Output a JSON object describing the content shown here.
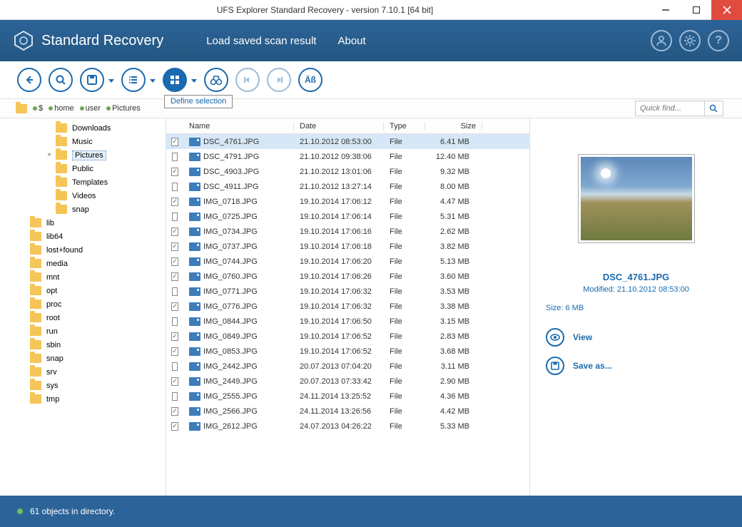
{
  "window": {
    "title": "UFS Explorer Standard Recovery - version 7.10.1 [64 bit]"
  },
  "header": {
    "app_name": "Standard Recovery",
    "menu_load": "Load saved scan result",
    "menu_about": "About"
  },
  "tooltip": {
    "define_selection": "Define selection"
  },
  "breadcrumb": [
    "$",
    "home",
    "user",
    "Pictures"
  ],
  "quickfind_placeholder": "Quick find...",
  "tree": [
    {
      "label": "Downloads",
      "depth": 3,
      "twisty": ""
    },
    {
      "label": "Music",
      "depth": 3,
      "twisty": ""
    },
    {
      "label": "Pictures",
      "depth": 3,
      "twisty": "+",
      "selected": true
    },
    {
      "label": "Public",
      "depth": 3,
      "twisty": ""
    },
    {
      "label": "Templates",
      "depth": 3,
      "twisty": ""
    },
    {
      "label": "Videos",
      "depth": 3,
      "twisty": ""
    },
    {
      "label": "snap",
      "depth": 3,
      "twisty": ""
    },
    {
      "label": "lib",
      "depth": 1,
      "twisty": ""
    },
    {
      "label": "lib64",
      "depth": 1,
      "twisty": ""
    },
    {
      "label": "lost+found",
      "depth": 1,
      "twisty": ""
    },
    {
      "label": "media",
      "depth": 1,
      "twisty": ""
    },
    {
      "label": "mnt",
      "depth": 1,
      "twisty": ""
    },
    {
      "label": "opt",
      "depth": 1,
      "twisty": ""
    },
    {
      "label": "proc",
      "depth": 1,
      "twisty": ""
    },
    {
      "label": "root",
      "depth": 1,
      "twisty": ""
    },
    {
      "label": "run",
      "depth": 1,
      "twisty": ""
    },
    {
      "label": "sbin",
      "depth": 1,
      "twisty": ""
    },
    {
      "label": "snap",
      "depth": 1,
      "twisty": ""
    },
    {
      "label": "srv",
      "depth": 1,
      "twisty": ""
    },
    {
      "label": "sys",
      "depth": 1,
      "twisty": ""
    },
    {
      "label": "tmp",
      "depth": 1,
      "twisty": ""
    }
  ],
  "columns": {
    "name": "Name",
    "date": "Date",
    "type": "Type",
    "size": "Size"
  },
  "files": [
    {
      "checked": true,
      "name": "DSC_4761.JPG",
      "date": "21.10.2012 08:53:00",
      "type": "File",
      "size": "6.41 MB",
      "selected": true
    },
    {
      "checked": false,
      "name": "DSC_4791.JPG",
      "date": "21.10.2012 09:38:06",
      "type": "File",
      "size": "12.40 MB"
    },
    {
      "checked": true,
      "name": "DSC_4903.JPG",
      "date": "21.10.2012 13:01:06",
      "type": "File",
      "size": "9.32 MB"
    },
    {
      "checked": false,
      "name": "DSC_4911.JPG",
      "date": "21.10.2012 13:27:14",
      "type": "File",
      "size": "8.00 MB"
    },
    {
      "checked": true,
      "name": "IMG_0718.JPG",
      "date": "19.10.2014 17:06:12",
      "type": "File",
      "size": "4.47 MB"
    },
    {
      "checked": false,
      "name": "IMG_0725.JPG",
      "date": "19.10.2014 17:06:14",
      "type": "File",
      "size": "5.31 MB"
    },
    {
      "checked": true,
      "name": "IMG_0734.JPG",
      "date": "19.10.2014 17:06:16",
      "type": "File",
      "size": "2.62 MB"
    },
    {
      "checked": true,
      "name": "IMG_0737.JPG",
      "date": "19.10.2014 17:06:18",
      "type": "File",
      "size": "3.82 MB"
    },
    {
      "checked": true,
      "name": "IMG_0744.JPG",
      "date": "19.10.2014 17:06:20",
      "type": "File",
      "size": "5.13 MB"
    },
    {
      "checked": true,
      "name": "IMG_0760.JPG",
      "date": "19.10.2014 17:06:26",
      "type": "File",
      "size": "3.60 MB"
    },
    {
      "checked": false,
      "name": "IMG_0771.JPG",
      "date": "19.10.2014 17:06:32",
      "type": "File",
      "size": "3.53 MB"
    },
    {
      "checked": true,
      "name": "IMG_0776.JPG",
      "date": "19.10.2014 17:06:32",
      "type": "File",
      "size": "3.38 MB"
    },
    {
      "checked": false,
      "name": "IMG_0844.JPG",
      "date": "19.10.2014 17:06:50",
      "type": "File",
      "size": "3.15 MB"
    },
    {
      "checked": true,
      "name": "IMG_0849.JPG",
      "date": "19.10.2014 17:06:52",
      "type": "File",
      "size": "2.83 MB"
    },
    {
      "checked": true,
      "name": "IMG_0853.JPG",
      "date": "19.10.2014 17:06:52",
      "type": "File",
      "size": "3.68 MB"
    },
    {
      "checked": false,
      "name": "IMG_2442.JPG",
      "date": "20.07.2013 07:04:20",
      "type": "File",
      "size": "3.11 MB"
    },
    {
      "checked": true,
      "name": "IMG_2449.JPG",
      "date": "20.07.2013 07:33:42",
      "type": "File",
      "size": "2.90 MB"
    },
    {
      "checked": false,
      "name": "IMG_2555.JPG",
      "date": "24.11.2014 13:25:52",
      "type": "File",
      "size": "4.36 MB"
    },
    {
      "checked": true,
      "name": "IMG_2566.JPG",
      "date": "24.11.2014 13:26:56",
      "type": "File",
      "size": "4.42 MB"
    },
    {
      "checked": true,
      "name": "IMG_2612.JPG",
      "date": "24.07.2013 04:26:22",
      "type": "File",
      "size": "5.33 MB"
    }
  ],
  "preview": {
    "name": "DSC_4761.JPG",
    "modified_label": "Modified: 21.10.2012 08:53:00",
    "size_label": "Size: 6 MB",
    "view": "View",
    "saveas": "Save as..."
  },
  "status": {
    "text": "61 objects in directory."
  }
}
